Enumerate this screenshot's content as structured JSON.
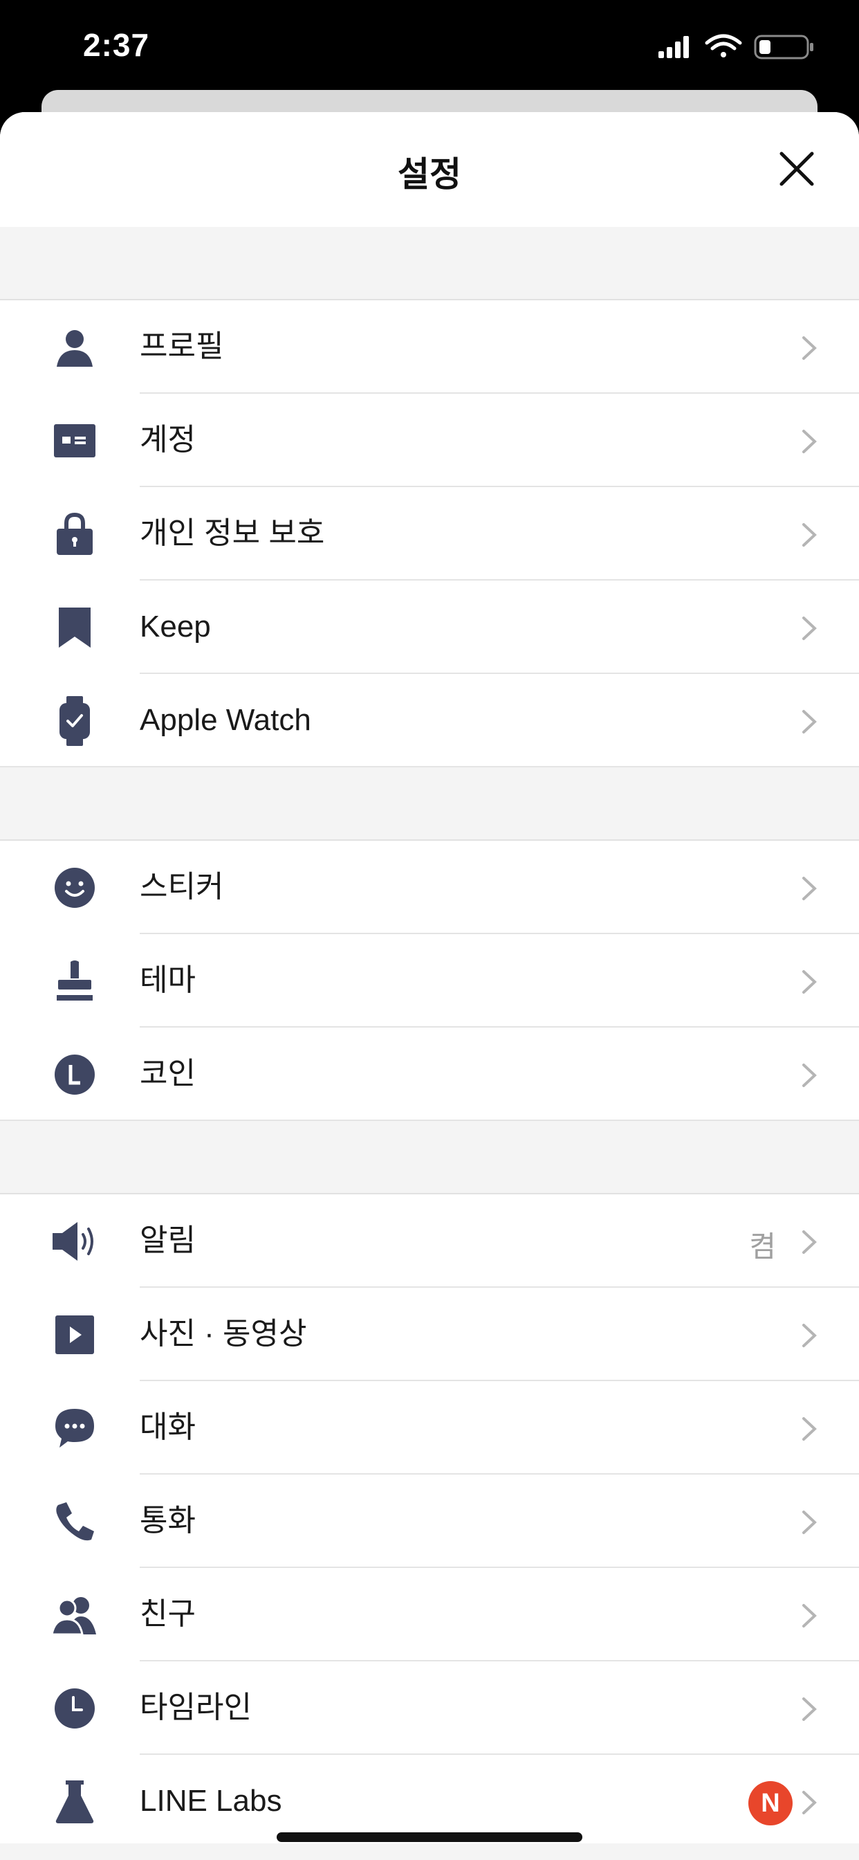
{
  "status_bar": {
    "time": "2:37"
  },
  "header": {
    "title": "설정"
  },
  "colors": {
    "icon": "#3f4662",
    "badge": "#e8462b",
    "section_bg": "#f4f4f4"
  },
  "sections": [
    {
      "items": [
        {
          "label": "프로필",
          "icon": "person-icon"
        },
        {
          "label": "계정",
          "icon": "id-card-icon"
        },
        {
          "label": "개인 정보 보호",
          "icon": "lock-icon"
        },
        {
          "label": "Keep",
          "icon": "bookmark-icon"
        },
        {
          "label": "Apple Watch",
          "icon": "watch-icon"
        }
      ]
    },
    {
      "items": [
        {
          "label": "스티커",
          "icon": "smiley-icon"
        },
        {
          "label": "테마",
          "icon": "stamp-icon"
        },
        {
          "label": "코인",
          "icon": "coin-icon"
        }
      ]
    },
    {
      "items": [
        {
          "label": "알림",
          "icon": "speaker-icon",
          "value": "켬"
        },
        {
          "label": "사진 · 동영상",
          "icon": "play-icon"
        },
        {
          "label": "대화",
          "icon": "chat-bubble-icon"
        },
        {
          "label": "통화",
          "icon": "phone-icon"
        },
        {
          "label": "친구",
          "icon": "friends-icon"
        },
        {
          "label": "타임라인",
          "icon": "clock-icon"
        },
        {
          "label": "LINE Labs",
          "icon": "flask-icon",
          "badge": "N"
        }
      ]
    }
  ]
}
